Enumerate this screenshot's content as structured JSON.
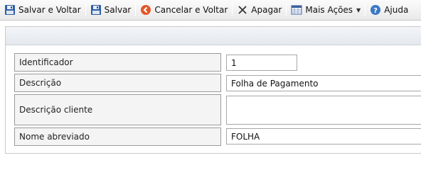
{
  "toolbar": {
    "save_back": "Salvar e Voltar",
    "save": "Salvar",
    "cancel_back": "Cancelar e Voltar",
    "delete": "Apagar",
    "more_actions": "Mais Ações",
    "help": "Ajuda"
  },
  "form": {
    "identifier": {
      "label": "Identificador",
      "value": "1"
    },
    "description": {
      "label": "Descrição",
      "value": "Folha de Pagamento"
    },
    "client_description": {
      "label": "Descrição cliente",
      "value": ""
    },
    "short_name": {
      "label": "Nome abreviado",
      "value": "FOLHA"
    }
  },
  "icons": {
    "save": "floppy-disk-icon",
    "cancel": "orange-circle-back-icon",
    "delete": "x-icon",
    "more_actions": "spreadsheet-icon",
    "help": "blue-question-icon"
  }
}
